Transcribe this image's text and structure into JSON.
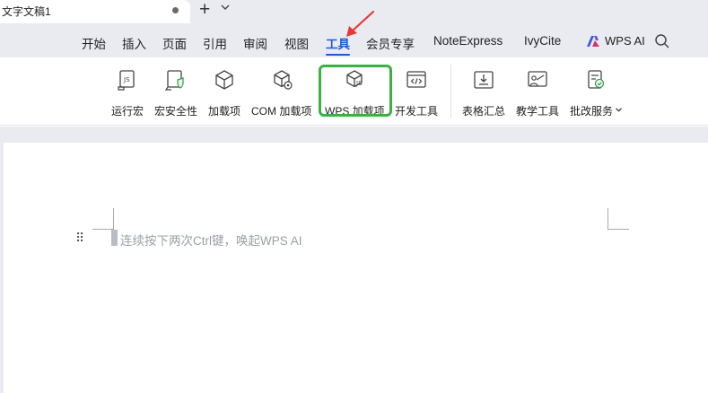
{
  "tabs": {
    "document_title": "文字文稿1",
    "new_tab_symbol": "+",
    "dropdown_symbol": "⌄"
  },
  "menu": {
    "items": [
      "开始",
      "插入",
      "页面",
      "引用",
      "审阅",
      "视图",
      "工具",
      "会员专享",
      "NoteExpress",
      "IvyCite"
    ],
    "active": "工具",
    "wps_ai": "WPS AI"
  },
  "ribbon": {
    "tools": [
      {
        "label": "运行宏",
        "icon": "run-macro-icon"
      },
      {
        "label": "宏安全性",
        "icon": "macro-security-icon"
      },
      {
        "label": "加载项",
        "icon": "addins-icon"
      },
      {
        "label": "COM 加载项",
        "icon": "com-addins-icon"
      },
      {
        "label": "WPS 加载项",
        "icon": "wps-addins-icon"
      },
      {
        "label": "开发工具",
        "icon": "developer-tools-icon"
      },
      {
        "label": "表格汇总",
        "icon": "table-summary-icon"
      },
      {
        "label": "教学工具",
        "icon": "teaching-tools-icon"
      },
      {
        "label": "批改服务",
        "icon": "correction-service-icon"
      }
    ],
    "highlighted": "WPS 加载项"
  },
  "document": {
    "placeholder": "连续按下两次Ctrl键，唤起WPS AI"
  },
  "colors": {
    "accent": "#1c5bd6",
    "highlight_box": "#3cb043",
    "annotation_arrow": "#e53935"
  }
}
